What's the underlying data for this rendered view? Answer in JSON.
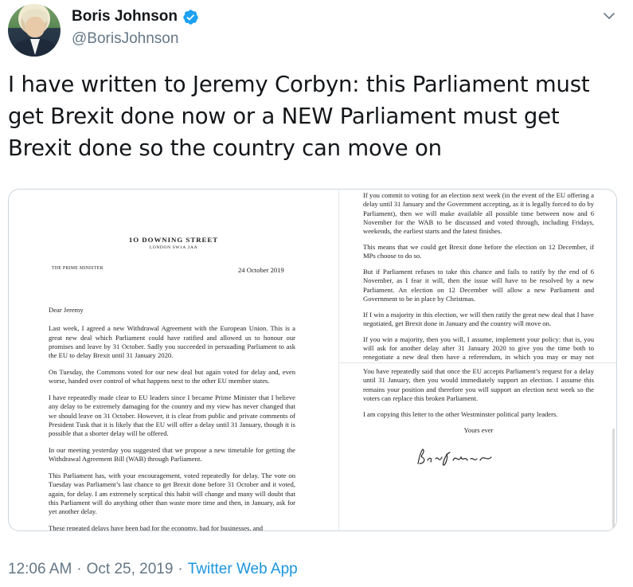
{
  "author": {
    "name": "Boris Johnson",
    "handle": "@BorisJohnson"
  },
  "tweet": {
    "text": "I have written to Jeremy Corbyn: this Parliament must get Brexit done now or a NEW Parliament must get Brexit done so the country can move on"
  },
  "letter": {
    "letterhead_title": "1O DOWNING STREET",
    "letterhead_sub": "LONDON SW1A 2AA",
    "pm_label": "THE PRIME MINISTER",
    "date": "24 October 2019",
    "salutation": "Dear Jeremy",
    "left_paragraphs": [
      "Last week, I agreed a new Withdrawal Agreement with the European Union. This is a great new deal which Parliament could have ratified and allowed us to honour our promises and leave by 31 October. Sadly you succeeded in persuading Parliament to ask the EU to delay Brexit until 31 January 2020.",
      "On Tuesday, the Commons voted for our new deal but again voted for delay and, even worse, handed over control of what happens next to the other EU member states.",
      "I have repeatedly made clear to EU leaders since I became Prime Minister that I believe any delay to be extremely damaging for the country and my view has never changed that we should leave on 31 October. However, it is clear from public and private comments of President Tusk that it is likely that the EU will offer a delay until 31 January, though it is possible that a shorter delay will be offered.",
      "In our meeting yesterday you suggested that we propose a new timetable for getting the Withdrawal Agreement Bill (WAB) through Parliament.",
      "This Parliament has, with your encouragement, voted repeatedly for delay. The vote on Tuesday was Parliament’s last chance to get Brexit done before 31 October and it voted, again, for delay. I am extremely sceptical this habit will change and many will doubt that this Parliament will do anything other than waste more time and then, in January, ask for yet another delay.",
      "These repeated delays have been bad for the economy, bad for businesses, and"
    ],
    "right_top_paragraphs": [
      "If you commit to voting for an election next week (in the event of the EU offering a delay until 31 January and the Government accepting, as it is legally forced to do by Parliament), then we will make available all possible time between now and 6 November for the WAB to be discussed and voted through, including Fridays, weekends, the earliest starts and the latest finishes.",
      "This means that we could get Brexit done before the election on 12 December, if MPs choose to do so.",
      "But if Parliament refuses to take this chance and fails to ratify by the end of 6 November, as I fear it will, then the issue will have to be resolved by a new Parliament. An election on 12 December will allow a new Parliament and Government to be in place by Christmas.",
      "If I win a majority in this election, we will then ratify the great new deal that I have negotiated, get Brexit done in January and the country will move on.",
      "If you win a majority, then you will, I assume, implement your policy: that is, you will ask for another delay after 31 January 2020 to give you the time both to renegotiate a new deal then have a referendum, in which you may or may not campaign for your own deal."
    ],
    "right_bottom_paragraphs": [
      "You have repeatedly said that once the EU accepts Parliament’s request for a delay until 31 January, then you would immediately support an election. I assume this remains your position and therefore you will support an election next week so the voters can replace this broken Parliament.",
      "I am copying this letter to the other Westminster political party leaders."
    ],
    "sign_off": "Yours ever"
  },
  "meta": {
    "time": "12:06 AM",
    "separator": "·",
    "date": "Oct 25, 2019",
    "source": "Twitter Web App"
  },
  "icons": {
    "verified": "verified-badge-icon",
    "caret": "chevron-down-icon"
  },
  "colors": {
    "verified_blue": "#1da1f2",
    "link_blue": "#1b95e0",
    "secondary_text": "#657786",
    "primary_text": "#14171a"
  }
}
